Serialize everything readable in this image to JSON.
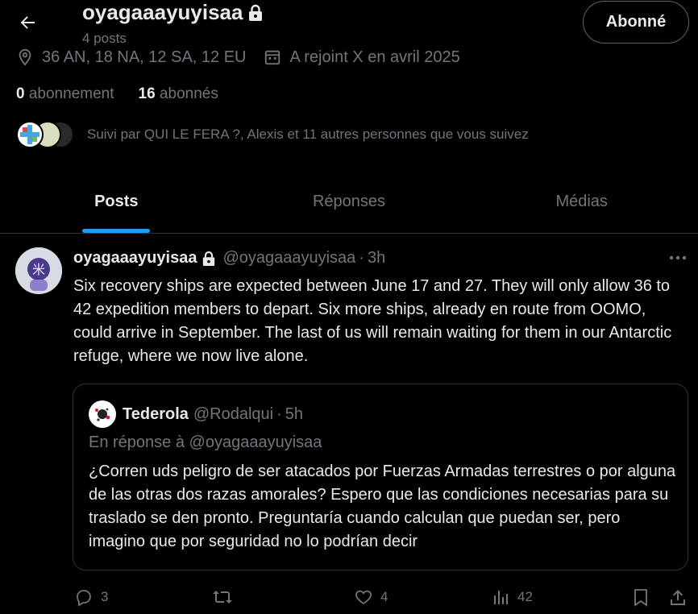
{
  "header": {
    "profile_name": "oyagaaayuyisaa",
    "post_count": "4 posts",
    "follow_button": "Abonné"
  },
  "profile": {
    "location": "36 AN, 18 NA, 12 SA, 12 EU",
    "joined": "A rejoint X en avril 2025",
    "following_count": "0",
    "following_label": "abonnement",
    "followers_count": "16",
    "followers_label": "abonnés",
    "followed_by": "Suivi par QUI LE FERA ?, Alexis et 11 autres personnes que vous suivez"
  },
  "tabs": [
    {
      "label": "Posts",
      "active": true
    },
    {
      "label": "Réponses",
      "active": false
    },
    {
      "label": "Médias",
      "active": false
    }
  ],
  "tweet": {
    "name": "oyagaaayuyisaa",
    "handle": "@oyagaaayuyisaa",
    "separator": "·",
    "time": "3h",
    "text": "Six recovery ships are expected between June 17 and 27. They will only allow 36 to 42 expedition members to depart. Six more ships, already en route from OOMO, could arrive in September. The last of us will remain waiting for them in our Antarctic refuge, where we now live alone.",
    "quote": {
      "name": "Tederola",
      "handle": "@Rodalqui",
      "separator": "·",
      "time": "5h",
      "reply_to": "En réponse à @oyagaaayuyisaa",
      "text": "¿Corren uds peligro de ser atacados por Fuerzas Armadas terrestres o por alguna de las otras dos razas amorales? Espero que las condiciones necesarias para su traslado se den pronto. Preguntaría cuando calculan que puedan ser, pero imagino que por seguridad no lo podrían decir"
    },
    "actions": {
      "replies": "3",
      "reposts": "",
      "likes": "4",
      "views": "42"
    }
  },
  "colors": {
    "background": "#000000",
    "text": "#e7e9ea",
    "muted": "#71767b",
    "accent": "#1d9bf0",
    "border": "#2f3336"
  }
}
